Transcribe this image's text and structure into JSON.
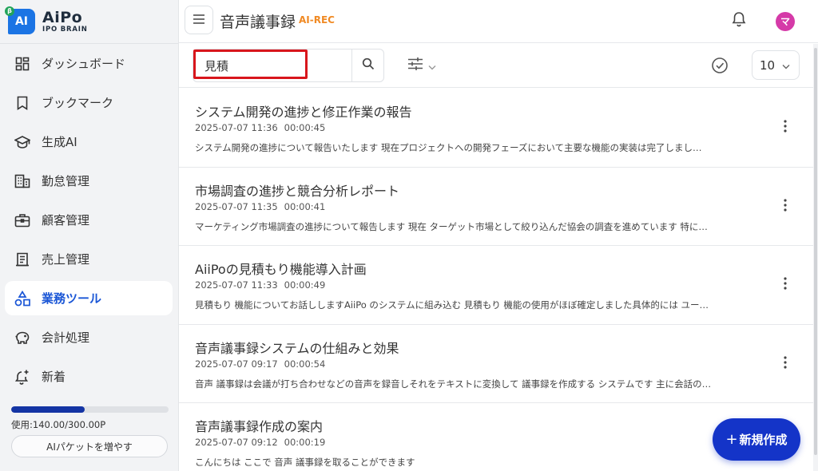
{
  "brand": {
    "name": "AiPo",
    "sub": "IPO BRAIN",
    "mark": "AI",
    "beta": "β",
    "accent": "#1b74e4"
  },
  "header": {
    "title": "音声議事録",
    "badge": "AI-REC",
    "badge_color": "#f08a24",
    "avatar_initial": "マ",
    "avatar_color": "#d53aa8"
  },
  "sidebar": {
    "items": [
      {
        "label": "ダッシュボード",
        "icon": "dashboard-icon",
        "active": false
      },
      {
        "label": "ブックマーク",
        "icon": "bookmark-icon",
        "active": false
      },
      {
        "label": "生成AI",
        "icon": "graduation-cap-icon",
        "active": false
      },
      {
        "label": "勤怠管理",
        "icon": "building-icon",
        "active": false
      },
      {
        "label": "顧客管理",
        "icon": "briefcase-icon",
        "active": false
      },
      {
        "label": "売上管理",
        "icon": "receipt-icon",
        "active": false
      },
      {
        "label": "業務ツール",
        "icon": "shapes-icon",
        "active": true
      },
      {
        "label": "会計処理",
        "icon": "piggy-bank-icon",
        "active": false
      },
      {
        "label": "新着",
        "icon": "bell-plus-icon",
        "active": false
      }
    ],
    "usage_fraction": 0.4667,
    "usage_text": "使用:140.00/300.00P",
    "packet_button": "AIパケットを増やす"
  },
  "toolbar": {
    "search_value": "見積",
    "per_page": "10"
  },
  "records": [
    {
      "title": "システム開発の進捗と修正作業の報告",
      "date": "2025-07-07 11:36",
      "duration": "00:00:45",
      "preview": "システム開発の進捗について報告いたします 現在プロジェクトへの開発フェーズにおいて主要な機能の実装は完了しまし…"
    },
    {
      "title": "市場調査の進捗と競合分析レポート",
      "date": "2025-07-07 11:35",
      "duration": "00:00:41",
      "preview": "マーケティング市場調査の進捗について報告します 現在 ターゲット市場として絞り込んだ協会の調査を進めています 特に…"
    },
    {
      "title": "AiiPoの見積もり機能導入計画",
      "date": "2025-07-07 11:33",
      "duration": "00:00:49",
      "preview": "見積もり 機能についてお話ししますAiiPo のシステムに組み込む 見積もり 機能の使用がほぼ確定しました具体的には ユー…"
    },
    {
      "title": "音声議事録システムの仕組みと効果",
      "date": "2025-07-07 09:17",
      "duration": "00:00:54",
      "preview": "音声 議事録は会議が打ち合わせなどの音声を録音しそれをテキストに変換して 議事録を作成する システムです 主に会話の…"
    },
    {
      "title": "音声議事録作成の案内",
      "date": "2025-07-07 09:12",
      "duration": "00:00:19",
      "preview": "こんにちは ここで 音声 議事録を取ることができます"
    }
  ],
  "fab": {
    "plus": "+",
    "label": "新規作成",
    "color": "#1434c8"
  }
}
